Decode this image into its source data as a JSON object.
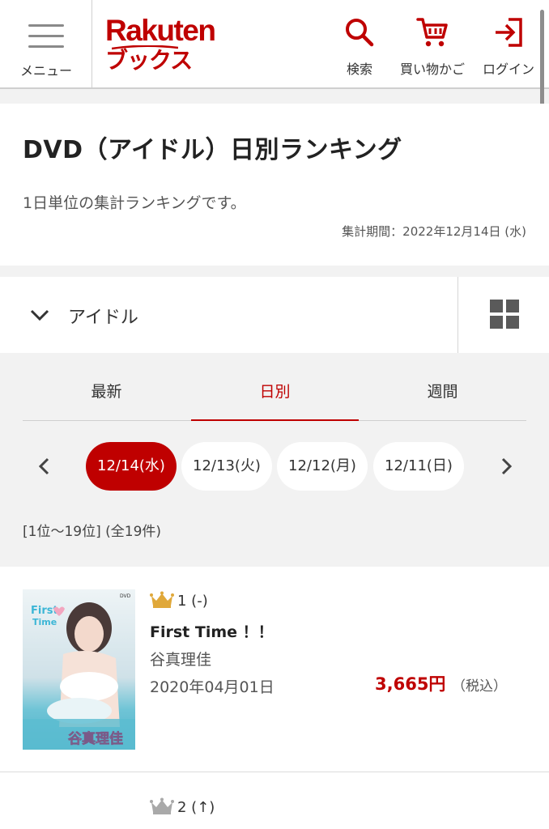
{
  "header": {
    "menu_label": "メニュー",
    "logo_top": "Rakuten",
    "logo_bottom": "ブックス",
    "search_label": "検索",
    "cart_label": "買い物かご",
    "login_label": "ログイン"
  },
  "page": {
    "title": "DVD（アイドル）日別ランキング",
    "description": "1日単位の集計ランキングです。",
    "period": "集計期間：2022年12月14日 (水)"
  },
  "filter": {
    "genre": "アイドル"
  },
  "tabs": [
    {
      "label": "最新",
      "active": false
    },
    {
      "label": "日別",
      "active": true
    },
    {
      "label": "週間",
      "active": false
    }
  ],
  "dates": [
    {
      "label": "12/14(水)",
      "active": true
    },
    {
      "label": "12/13(火)",
      "active": false
    },
    {
      "label": "12/12(月)",
      "active": false
    },
    {
      "label": "12/11(日)",
      "active": false
    }
  ],
  "result_count": "[1位〜19位] (全19件)",
  "items": [
    {
      "rank": "1 (-)",
      "title": "First Time ！！",
      "artist": "谷真理佳",
      "release_date": "2020年04月01日",
      "price": "3,665円",
      "tax": "（税込）",
      "cover_text": "First Time",
      "cover_name": "谷真理佳",
      "cover_badge": "DVD"
    },
    {
      "rank": "2 (↑)"
    }
  ],
  "colors": {
    "brand": "#bf0000",
    "crown_gold": "#e0a83a",
    "crown_silver": "#a9a9a9"
  }
}
